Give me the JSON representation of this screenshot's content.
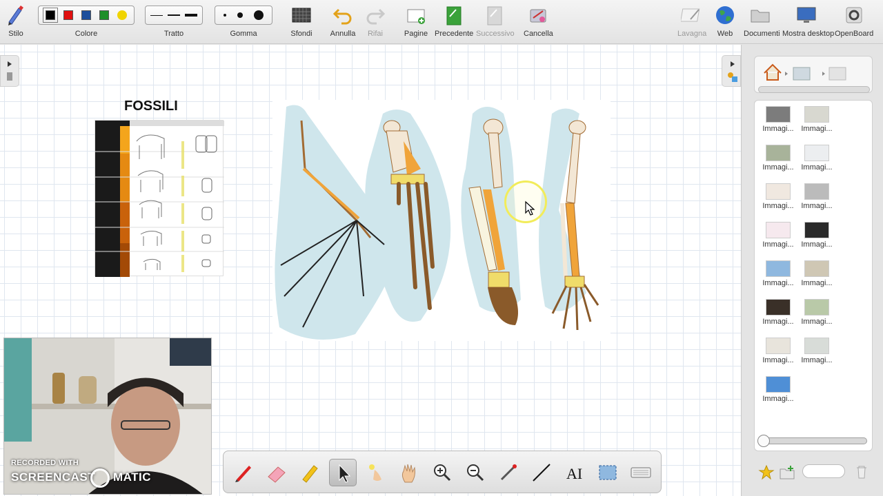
{
  "toolbar": {
    "stilo_label": "Stilo",
    "colore_label": "Colore",
    "tratto_label": "Tratto",
    "gomma_label": "Gomma",
    "sfondi_label": "Sfondi",
    "annulla_label": "Annulla",
    "rifai_label": "Rifai",
    "pagine_label": "Pagine",
    "precedente_label": "Precedente",
    "successivo_label": "Successivo",
    "cancella_label": "Cancella",
    "lavagna_label": "Lavagna",
    "web_label": "Web",
    "documenti_label": "Documenti",
    "mostra_desktop_label": "Mostra desktop",
    "openboard_label": "OpenBoard",
    "colors": [
      "#000000",
      "#e01010",
      "#1d4f9c",
      "#1f8f2a",
      "#f0d400"
    ],
    "selected_color": "#000000"
  },
  "board": {
    "title": "FOSSILI"
  },
  "library": {
    "items": [
      {
        "label": "Immagi..."
      },
      {
        "label": "Immagi..."
      },
      {
        "label": "Immagi..."
      },
      {
        "label": "Immagi..."
      },
      {
        "label": "Immagi..."
      },
      {
        "label": "Immagi..."
      },
      {
        "label": "Immagi..."
      },
      {
        "label": "Immagi..."
      },
      {
        "label": "Immagi..."
      },
      {
        "label": "Immagi..."
      },
      {
        "label": "Immagi..."
      },
      {
        "label": "Immagi..."
      },
      {
        "label": "Immagi..."
      },
      {
        "label": "Immagi..."
      },
      {
        "label": "Immagi..."
      }
    ]
  },
  "watermark": {
    "line1": "RECORDED WITH",
    "line2a": "SCREENCAST",
    "line2b": "MATIC"
  },
  "icons": {
    "stylus_tools": [
      "pen-icon",
      "eraser-icon",
      "highlighter-icon",
      "pointer-icon",
      "laser-pointer-icon",
      "hand-icon",
      "zoom-in-icon",
      "zoom-out-icon",
      "capture-icon",
      "line-icon",
      "text-icon",
      "selection-icon",
      "keyboard-icon"
    ]
  }
}
